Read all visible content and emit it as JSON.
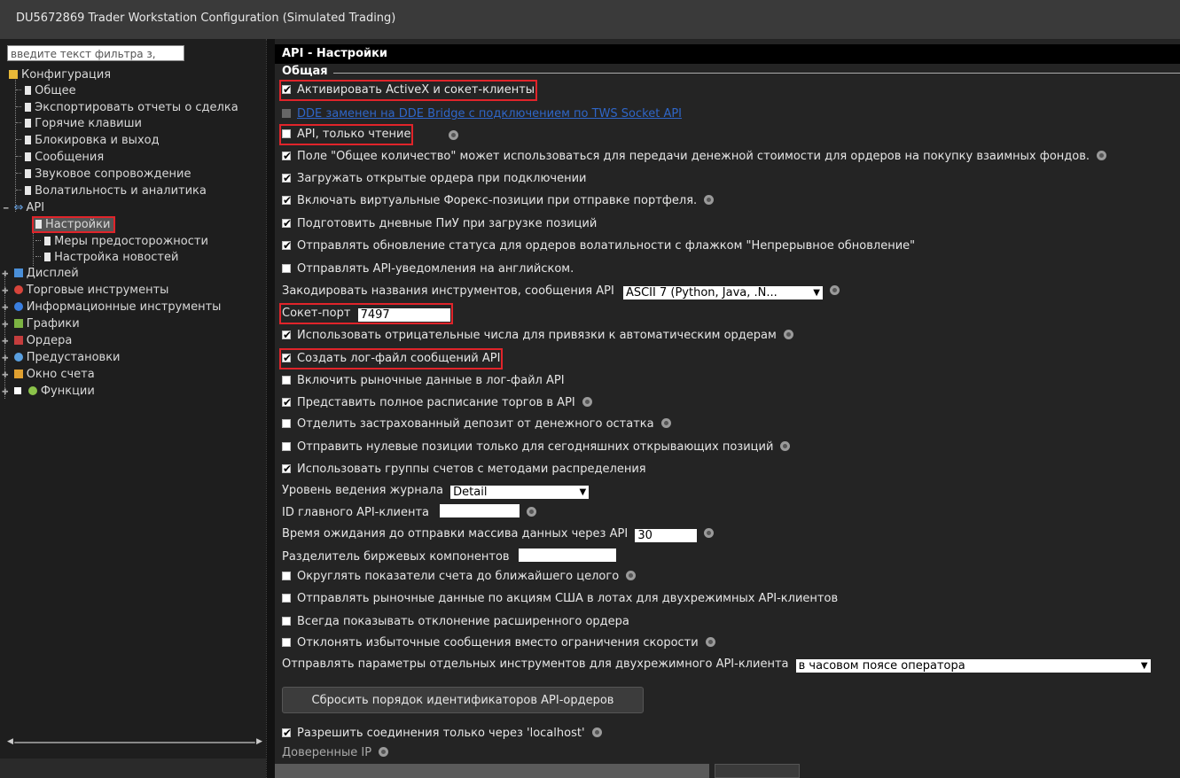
{
  "window": {
    "title": "DU5672869 Trader Workstation Configuration (Simulated Trading)"
  },
  "sidebar": {
    "filter_placeholder": "введите текст фильтра з,",
    "tree": [
      {
        "label": "Конфигурация",
        "icon": "folder-icon"
      },
      {
        "label": "Общее",
        "icon": "document-icon"
      },
      {
        "label": "Экспортировать отчеты о сделка",
        "icon": "document-icon"
      },
      {
        "label": "Горячие клавиши",
        "icon": "document-icon"
      },
      {
        "label": "Блокировка и выход",
        "icon": "document-icon"
      },
      {
        "label": "Сообщения",
        "icon": "document-icon"
      },
      {
        "label": "Звуковое сопровождение",
        "icon": "document-icon"
      },
      {
        "label": "Волатильность и аналитика",
        "icon": "document-icon"
      },
      {
        "label": "API",
        "icon": "api-icon"
      },
      {
        "label": "Настройки",
        "icon": "document-icon",
        "selected": true
      },
      {
        "label": "Меры предосторожности",
        "icon": "document-icon"
      },
      {
        "label": "Настройка новостей",
        "icon": "document-icon"
      },
      {
        "label": "Дисплей",
        "icon": "display-icon"
      },
      {
        "label": "Торговые инструменты",
        "icon": "trading-tools-icon"
      },
      {
        "label": "Информационные инструменты",
        "icon": "info-icon"
      },
      {
        "label": "Графики",
        "icon": "chart-icon"
      },
      {
        "label": "Ордера",
        "icon": "orders-icon"
      },
      {
        "label": "Предустановки",
        "icon": "presets-icon"
      },
      {
        "label": "Окно счета",
        "icon": "account-icon"
      },
      {
        "label": "Функции",
        "icon": "features-icon"
      }
    ]
  },
  "main": {
    "title": "API - Настройки",
    "group": "Общая",
    "rows": [
      {
        "label": "Активировать ActiveX и сокет-клиенты",
        "checked": true
      },
      {
        "label": "DDE заменен на DDE Bridge с подключением по TWS Socket API"
      },
      {
        "label": "API, только чтение",
        "checked": false
      },
      {
        "label": "Поле \"Общее количество\" может использоваться для передачи денежной стоимости для ордеров на покупку взаимных фондов.",
        "checked": true
      },
      {
        "label": "Загружать открытые ордера при подключении",
        "checked": true
      },
      {
        "label": "Включать виртуальные Форекс-позиции при отправке портфеля.",
        "checked": true
      },
      {
        "label": "Подготовить дневные ПиУ при загрузке позиций",
        "checked": true
      },
      {
        "label": "Отправлять обновление статуса для ордеров волатильности с флажком \"Непрерывное обновление\"",
        "checked": true
      },
      {
        "label": "Отправлять API-уведомления на английском.",
        "checked": false
      },
      {
        "label": "Закодировать названия инструментов, сообщения API",
        "value": "ASCII 7 (Python, Java, .N..."
      },
      {
        "label": "Сокет-порт",
        "value": "7497"
      },
      {
        "label": "Использовать отрицательные числа для привязки к автоматическим ордерам",
        "checked": true
      },
      {
        "label": "Создать лог-файл сообщений API",
        "checked": true
      },
      {
        "label": "Включить рыночные данные в лог-файл API",
        "checked": false
      },
      {
        "label": "Представить полное расписание торгов в API",
        "checked": true
      },
      {
        "label": "Отделить застрахованный депозит от денежного остатка",
        "checked": false
      },
      {
        "label": "Отправить нулевые позиции только для сегодняшних открывающих позиций",
        "checked": false
      },
      {
        "label": "Использовать группы счетов с методами распределения",
        "checked": true
      },
      {
        "label": "Уровень ведения журнала",
        "value": "Detail"
      },
      {
        "label": "ID главного API-клиента",
        "value": ""
      },
      {
        "label": "Время ожидания до отправки массива данных через API",
        "value": "30"
      },
      {
        "label": "Разделитель биржевых компонентов",
        "value": ""
      },
      {
        "label": "Округлять показатели счета до ближайшего целого",
        "checked": false
      },
      {
        "label": "Отправлять рыночные данные по акциям США в лотах для двухрежимных API-клиентов",
        "checked": false
      },
      {
        "label": "Всегда показывать отклонение расширенного ордера",
        "checked": false
      },
      {
        "label": "Отклонять избыточные сообщения вместо ограничения скорости",
        "checked": false
      },
      {
        "label": "Отправлять параметры отдельных инструментов для двухрежимного API-клиента",
        "value": "в часовом поясе оператора"
      },
      {
        "label": "Сбросить порядок идентификаторов API-ордеров"
      },
      {
        "label": "Разрешить соединения только через 'localhost'",
        "checked": true
      },
      {
        "label": "Доверенные IP"
      }
    ]
  },
  "colors": {
    "highlight": "#e0242a",
    "background": "#242424",
    "link": "#2f66c8"
  }
}
